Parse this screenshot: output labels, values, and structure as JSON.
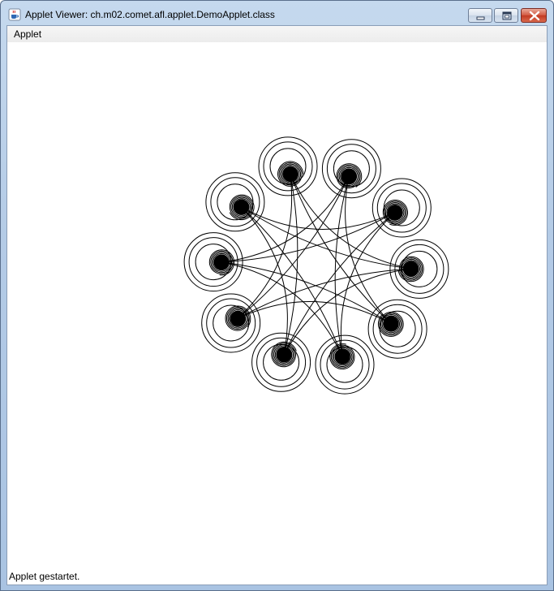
{
  "window": {
    "title": "Applet Viewer: ch.m02.comet.afl.applet.DemoApplet.class",
    "app_icon": "java-cup-icon",
    "controls": {
      "minimize_icon": "minimize-icon",
      "maximize_icon": "maximize-icon",
      "close_icon": "close-icon"
    }
  },
  "menubar": {
    "items": [
      {
        "label": "Applet"
      }
    ]
  },
  "status": {
    "text": "Applet gestartet."
  },
  "colors": {
    "drawing_stroke": "#000000",
    "canvas_background": "#ffffff",
    "close_button": "#c8432b"
  }
}
